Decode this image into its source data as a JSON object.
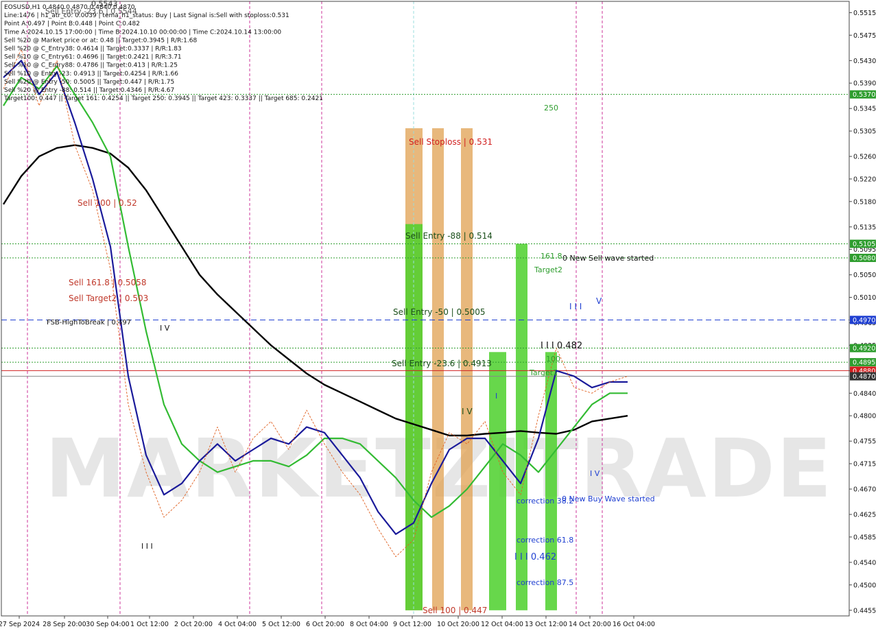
{
  "chart_data": {
    "type": "line",
    "symbol": "EOSUSD,H1",
    "header_lines": [
      "EOSUSD,H1  0.4840 0.4870 0.4840 0.4870",
      "Line:1476 | h1_atr_c0: 0.0039 | tema_h1_status: Buy | Last Signal is:Sell with stoploss:0.531",
      "Point A:0.497 | Point B:0.448 | Point C:0.482",
      "Time A:2024.10.15 17:00:00 | Time B:2024.10.10 00:00:00 | Time C:2024.10.14 13:00:00",
      "Sell %20 @ Market price or at: 0.48 || Target:0.3945 | R/R:1.68",
      "Sell %20 @ C_Entry38: 0.4614 || Target:0.3337 | R/R:1.83",
      "Sell %10 @ C_Entry61: 0.4696 || Target:0.2421 | R/R:3.71",
      "Sell %10 @ C_Entry88: 0.4786 || Target:0.413 | R/R:1.25",
      "Sell %10 @ Entry -23: 0.4913 || Target:0.4254 | R/R:1.66",
      "Sell %20 @ Entry -50: 0.5005 || Target:0.447 | R/R:1.75",
      "Sell %20 @ Entry -88: 0.514 || Target:0.4346 | R/R:4.67",
      "Target100: 0.447 || Target 161: 0.4254 || Target 250: 0.3945 || Target 423: 0.3337 || Target 685: 0.2421"
    ],
    "y_ticks": [
      "0.5515",
      "0.5475",
      "0.5430",
      "0.5390",
      "0.5345",
      "0.5305",
      "0.5260",
      "0.5220",
      "0.5180",
      "0.5135",
      "0.5095",
      "0.5050",
      "0.5010",
      "0.4965",
      "0.4925",
      "0.4880",
      "0.4840",
      "0.4800",
      "0.4755",
      "0.4715",
      "0.4670",
      "0.4625",
      "0.4585",
      "0.4540",
      "0.4500",
      "0.4455"
    ],
    "x_ticks": [
      "27 Sep 2024",
      "28 Sep 20:00",
      "30 Sep 04:00",
      "1 Oct 12:00",
      "2 Oct 20:00",
      "4 Oct 04:00",
      "5 Oct 12:00",
      "6 Oct 20:00",
      "8 Oct 04:00",
      "9 Oct 12:00",
      "10 Oct 20:00",
      "12 Oct 04:00",
      "13 Oct 12:00",
      "14 Oct 20:00",
      "16 Oct 04:00"
    ],
    "ylim": [
      0.4445,
      0.5535
    ],
    "price_badges": [
      {
        "value": "0.5370",
        "color": "#2e9d2e"
      },
      {
        "value": "0.5105",
        "color": "#2e9d2e"
      },
      {
        "value": "0.5080",
        "color": "#2e9d2e"
      },
      {
        "value": "0.4970",
        "color": "#1f3fd1"
      },
      {
        "value": "0.4920",
        "color": "#2e9d2e"
      },
      {
        "value": "0.4895",
        "color": "#2e9d2e"
      },
      {
        "value": "0.4880",
        "color": "#d11f1f"
      },
      {
        "value": "0.4870",
        "color": "#333333"
      }
    ],
    "levels": [
      {
        "value": 0.537,
        "color": "#2e9d2e",
        "style": "dotted"
      },
      {
        "value": 0.5105,
        "color": "#2e9d2e",
        "style": "dotted"
      },
      {
        "value": 0.508,
        "color": "#2e9d2e",
        "style": "dotted"
      },
      {
        "value": 0.497,
        "color": "#1f3fd1",
        "style": "dashed"
      },
      {
        "value": 0.492,
        "color": "#2e9d2e",
        "style": "dotted"
      },
      {
        "value": 0.4895,
        "color": "#2e9d2e",
        "style": "dotted"
      },
      {
        "value": 0.488,
        "color": "#d11f1f",
        "style": "solid"
      },
      {
        "value": 0.487,
        "color": "#888888",
        "style": "solid"
      }
    ],
    "annotations": [
      {
        "text": "Sell Entry -23.6 | 0.5544",
        "color": "#555555"
      },
      {
        "text": "0.5543",
        "color": "#333333"
      },
      {
        "text": "250",
        "color": "#2e9d2e"
      },
      {
        "text": "Sell Stoploss | 0.531",
        "color": "#d11f1f"
      },
      {
        "text": "Sell 100 | 0.52",
        "color": "#c0392b"
      },
      {
        "text": "Sell Entry -88 | 0.514",
        "color": "#1b4f1b"
      },
      {
        "text": "161.8",
        "color": "#2e9d2e"
      },
      {
        "text": "0 New Sell wave started",
        "color": "#111111"
      },
      {
        "text": "Target2",
        "color": "#2e9d2e"
      },
      {
        "text": "Sell 161.8 | 0.5058",
        "color": "#c0392b"
      },
      {
        "text": "Sell Target2 | 0.503",
        "color": "#c0392b"
      },
      {
        "text": "I I I",
        "color": "#1f3fd1"
      },
      {
        "text": "V",
        "color": "#1f3fd1"
      },
      {
        "text": "FSB-HighToBreak | 0.497",
        "color": "#111111"
      },
      {
        "text": "Sell Entry -50 | 0.5005",
        "color": "#1b4f1b"
      },
      {
        "text": "I V",
        "color": "#111111"
      },
      {
        "text": "I I I  0.482",
        "color": "#111111"
      },
      {
        "text": "100",
        "color": "#2e9d2e"
      },
      {
        "text": "Target1",
        "color": "#2e9d2e"
      },
      {
        "text": "Sell Entry -23.6 | 0.4913",
        "color": "#1b4f1b"
      },
      {
        "text": "I V",
        "color": "#1b4f1b"
      },
      {
        "text": "I",
        "color": "#1f3fd1"
      },
      {
        "text": "I V",
        "color": "#1f3fd1"
      },
      {
        "text": "correction 38.2",
        "color": "#1f3fd1"
      },
      {
        "text": "0 New Buy Wave started",
        "color": "#1f3fd1"
      },
      {
        "text": "correction 61.8",
        "color": "#1f3fd1"
      },
      {
        "text": "I I I  0.462",
        "color": "#1f3fd1"
      },
      {
        "text": "correction 87.5",
        "color": "#1f3fd1"
      },
      {
        "text": "I I I",
        "color": "#111111"
      },
      {
        "text": "Sell 100 | 0.447",
        "color": "#c0392b"
      }
    ],
    "watermark": "MARKETZITRADE",
    "series": [
      {
        "color": "#000000",
        "values": [
          0.5175,
          0.5225,
          0.526,
          0.5275,
          0.528,
          0.5275,
          0.5265,
          0.524,
          0.52,
          0.515,
          0.51,
          0.505,
          0.5015,
          0.4985,
          0.4955,
          0.4925,
          0.49,
          0.4875,
          0.4855,
          0.484,
          0.4825,
          0.481,
          0.4795,
          0.4785,
          0.4775,
          0.4765,
          0.4765,
          0.4768,
          0.477,
          0.4773,
          0.477,
          0.4768,
          0.4775,
          0.479,
          0.4795,
          0.48
        ]
      },
      {
        "color": "#33bb33",
        "values": [
          0.535,
          0.54,
          0.538,
          0.542,
          0.537,
          0.532,
          0.526,
          0.51,
          0.495,
          0.482,
          0.475,
          0.472,
          0.47,
          0.471,
          0.472,
          0.472,
          0.471,
          0.473,
          0.476,
          0.476,
          0.475,
          0.472,
          0.469,
          0.465,
          0.462,
          0.464,
          0.467,
          0.471,
          0.475,
          0.473,
          0.47,
          0.474,
          0.478,
          0.482,
          0.484,
          0.484
        ]
      },
      {
        "color": "#1a1a9a",
        "values": [
          0.54,
          0.543,
          0.537,
          0.541,
          0.532,
          0.522,
          0.51,
          0.487,
          0.473,
          0.466,
          0.468,
          0.472,
          0.475,
          0.472,
          0.474,
          0.476,
          0.475,
          0.478,
          0.477,
          0.473,
          0.469,
          0.463,
          0.459,
          0.461,
          0.468,
          0.474,
          0.476,
          0.476,
          0.472,
          0.468,
          0.476,
          0.488,
          0.487,
          0.485,
          0.486,
          0.486
        ]
      },
      {
        "color": "#e06020",
        "values": [
          0.538,
          0.545,
          0.535,
          0.543,
          0.528,
          0.52,
          0.506,
          0.482,
          0.47,
          0.462,
          0.465,
          0.47,
          0.478,
          0.47,
          0.476,
          0.479,
          0.474,
          0.481,
          0.475,
          0.47,
          0.466,
          0.46,
          0.455,
          0.458,
          0.47,
          0.477,
          0.475,
          0.479,
          0.47,
          0.466,
          0.48,
          0.492,
          0.485,
          0.484,
          0.486,
          0.487
        ]
      }
    ],
    "bands": [
      {
        "color": "#e0a050",
        "from": 0.4455,
        "to": 0.531
      },
      {
        "color": "#e0a050",
        "from": 0.4455,
        "to": 0.531
      },
      {
        "color": "#e0a050",
        "from": 0.4455,
        "to": 0.531
      },
      {
        "color": "#4cd02c",
        "from": 0.4455,
        "to": 0.514
      },
      {
        "color": "#4cd02c",
        "from": 0.4455,
        "to": 0.4913
      },
      {
        "color": "#4cd02c",
        "from": 0.4455,
        "to": 0.5105
      },
      {
        "color": "#4cd02c",
        "from": 0.4455,
        "to": 0.4913
      }
    ]
  }
}
